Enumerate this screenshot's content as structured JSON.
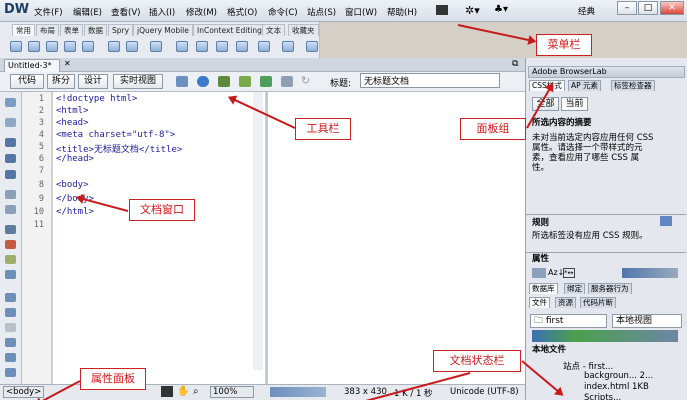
{
  "app": {
    "logo": "DW",
    "workspace": "经典",
    "win_min": "–",
    "win_max": "□",
    "win_close": "✕"
  },
  "menu": [
    "文件(F)",
    "编辑(E)",
    "查看(V)",
    "插入(I)",
    "修改(M)",
    "格式(O)",
    "命令(C)",
    "站点(S)",
    "窗口(W)",
    "帮助(H)"
  ],
  "insert_tabs": [
    "常用",
    "布局",
    "表单",
    "数据",
    "Spry",
    "jQuery Mobile",
    "InContext Editing",
    "文本",
    "收藏夹"
  ],
  "document": {
    "tab": "Untitled-3*",
    "view_buttons": [
      "代码",
      "拆分",
      "设计",
      "实时视图"
    ],
    "title_label": "标题:",
    "title_value": "无标题文档"
  },
  "code": {
    "line_numbers": [
      "1",
      "2",
      "3",
      "4",
      "5",
      "6",
      "7",
      "8",
      "9",
      "10",
      "11"
    ],
    "lines": [
      "<!doctype html>",
      "<html>",
      "<head>",
      "<meta charset=\"utf-8\">",
      "<title>无标题文档</title>",
      "</head>",
      "",
      "<body>",
      "</body>",
      "</html>",
      ""
    ]
  },
  "status": {
    "tag": "<body>",
    "zoom": "100%",
    "size": "383 x 430",
    "file": "1 K / 1 秒",
    "encoding": "Unicode (UTF-8)"
  },
  "panels": {
    "browserlab": "Adobe BrowserLab",
    "css_tabs": [
      "CSS样式",
      "AP 元素",
      "标签检查器"
    ],
    "css_buttons": [
      "全部",
      "当前"
    ],
    "summary_title": "所选内容的摘要",
    "summary_text": [
      "未对当前选定内容应用任何 CSS",
      "属性。请选择一个带样式的元",
      "素，查看应用了哪些 CSS 属",
      "性。"
    ],
    "rules_title": "规则",
    "rules_text": "所选标签没有应用 CSS 规则。",
    "props_title": "属性",
    "db_tabs": [
      "数据库",
      "绑定",
      "服务器行为"
    ],
    "file_tabs": [
      "文件",
      "资源",
      "代码片断"
    ],
    "site_select": "first",
    "view_select": "本地视图",
    "local_files": "本地文件",
    "tree": [
      "站点 - first...",
      "backgroun... 2...",
      "index.html   1KB",
      "Scripts..."
    ]
  },
  "annotations": {
    "menubar": "菜单栏",
    "toolbar": "工具栏",
    "panel_group": "面板组",
    "doc_window": "文档窗口",
    "property_panel": "属性面板",
    "doc_status": "文档状态栏"
  }
}
